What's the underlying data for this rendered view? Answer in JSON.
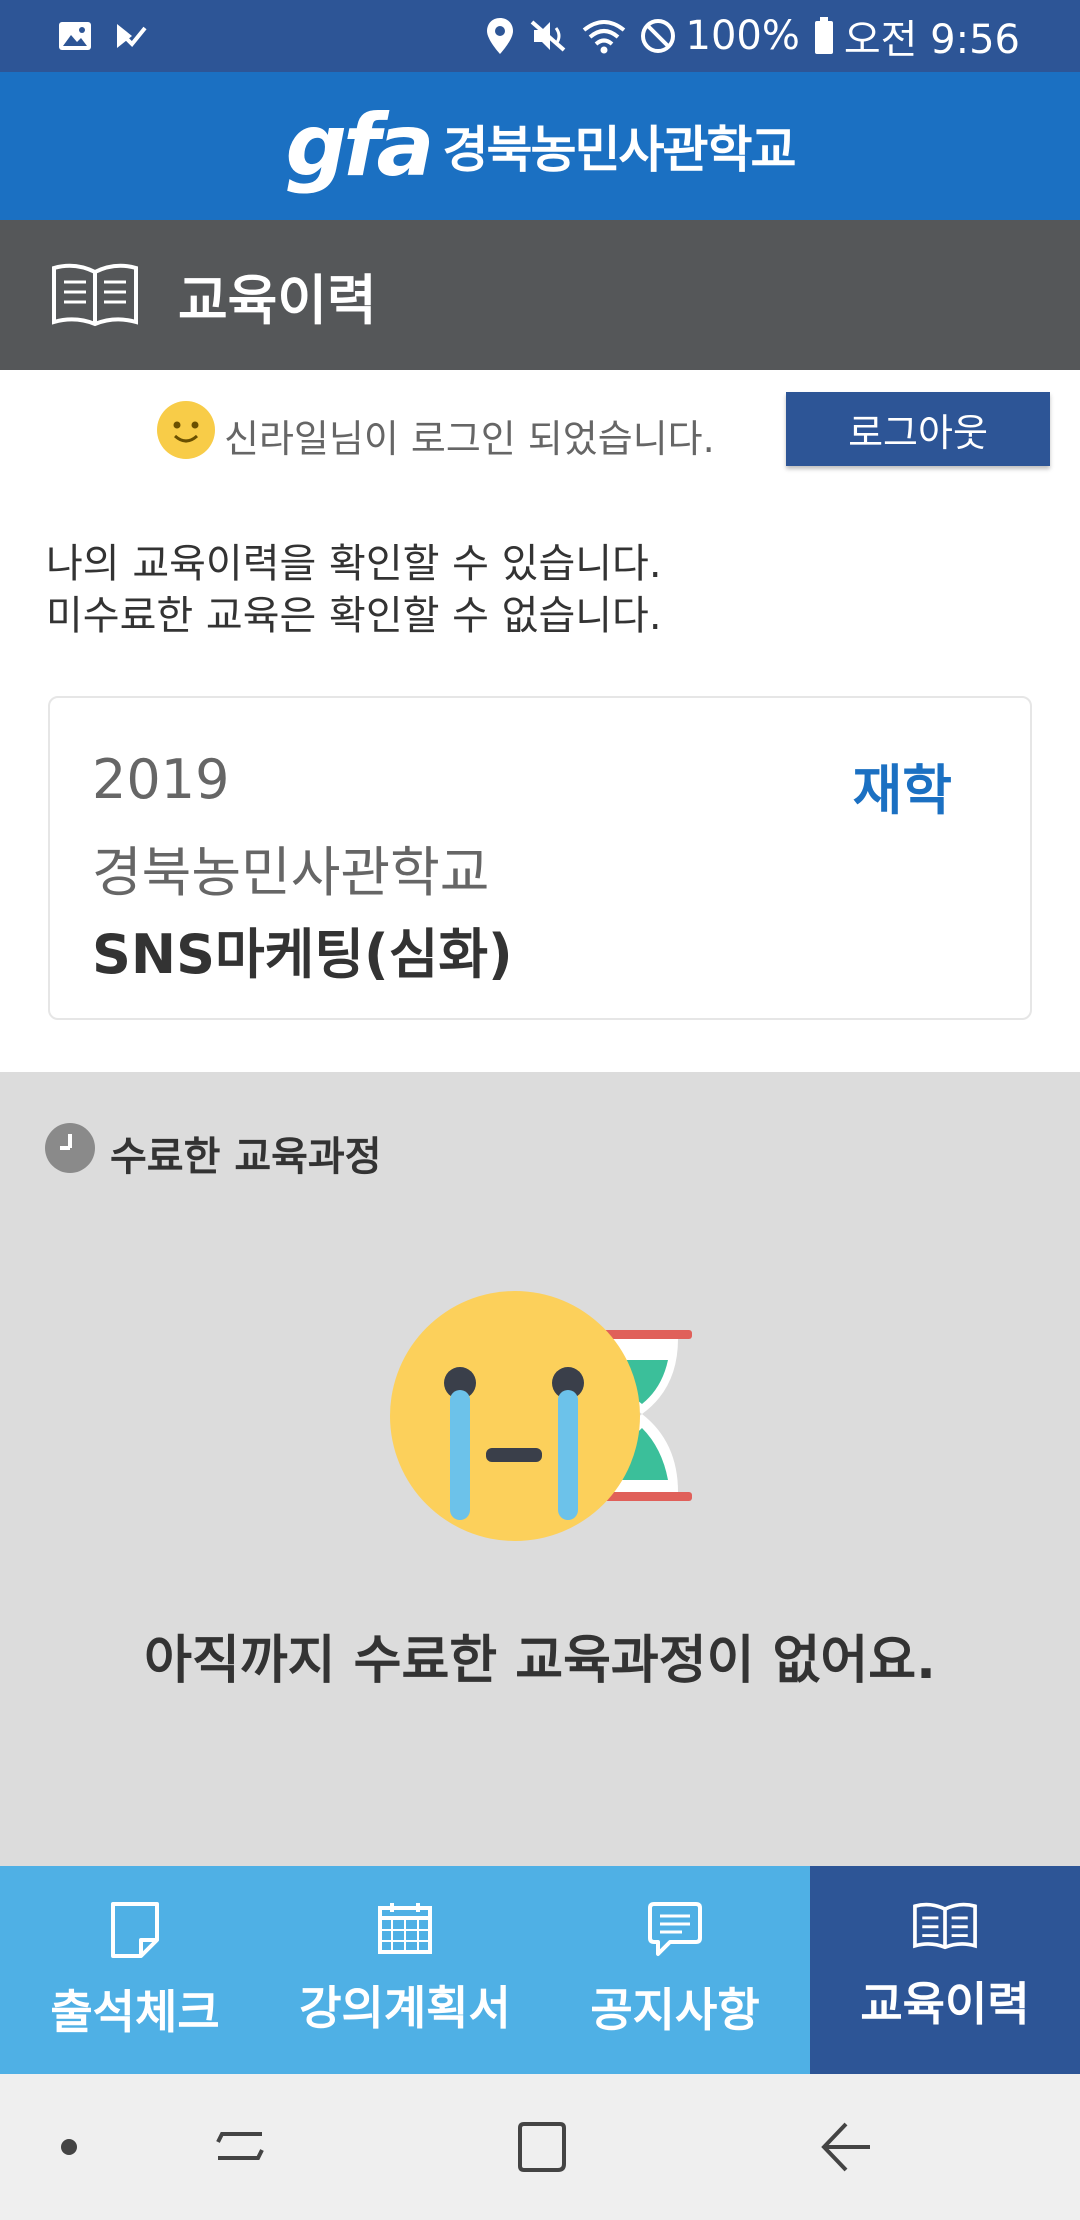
{
  "status_bar": {
    "battery": "100%",
    "time": "오전 9:56",
    "icons": [
      "image-icon",
      "check-notification-icon",
      "location-icon",
      "mute-icon",
      "wifi-icon",
      "block-icon",
      "battery-icon"
    ]
  },
  "header": {
    "logo_mark": "gfa",
    "school_name": "경북농민사관학교"
  },
  "title_bar": {
    "title": "교육이력",
    "icon": "book-icon"
  },
  "login": {
    "message": "신라일님이 로그인 되었습니다.",
    "logout_label": "로그아웃"
  },
  "intro": {
    "line1": "나의 교육이력을 확인할 수 있습니다.",
    "line2": "미수료한 교육은 확인할 수 없습니다."
  },
  "course_card": {
    "year": "2019",
    "school": "경북농민사관학교",
    "course": "SNS마케팅(심화)",
    "status": "재학"
  },
  "completed": {
    "title": "수료한 교육과정",
    "empty_message": "아직까지 수료한 교육과정이 없어요."
  },
  "tabs": [
    {
      "label": "출석체크",
      "icon": "note-icon",
      "active": false
    },
    {
      "label": "강의계획서",
      "icon": "calendar-icon",
      "active": false
    },
    {
      "label": "공지사항",
      "icon": "chat-bubble-icon",
      "active": false
    },
    {
      "label": "교육이력",
      "icon": "book-icon",
      "active": true
    }
  ],
  "colors": {
    "status_bar": "#2d5596",
    "header": "#1b70c2",
    "title_bar": "#555759",
    "accent": "#1b70c2",
    "tab_bg": "#4fb0e5",
    "tab_active": "#2d5596",
    "section_bg": "#dcdcdc"
  }
}
